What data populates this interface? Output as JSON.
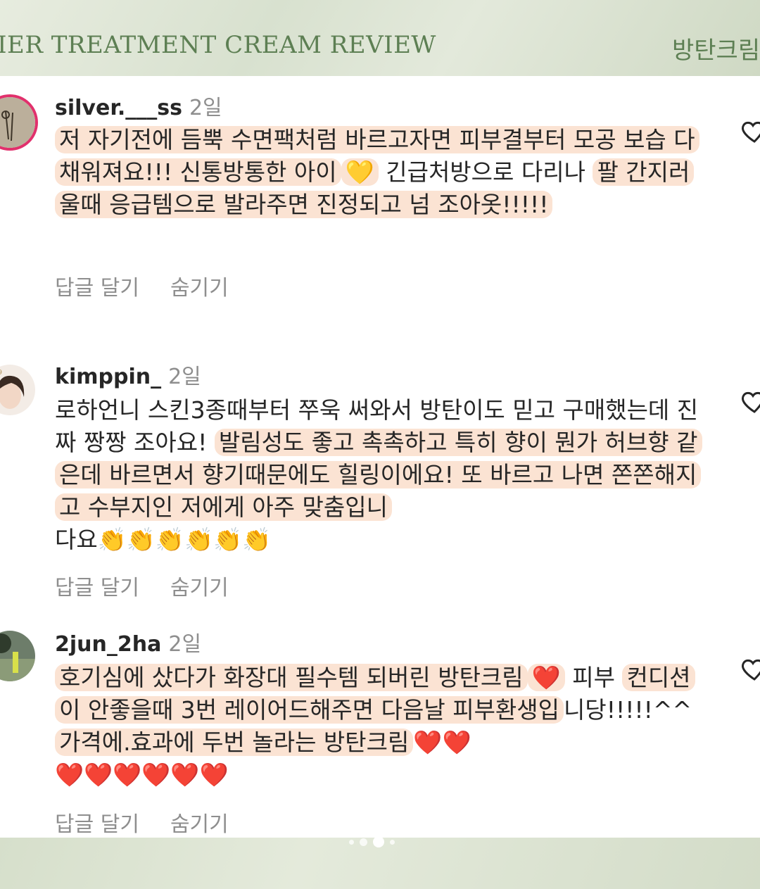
{
  "banner": {
    "title": "RIER TREATMENT CREAM REVIEW",
    "right_text": "방탄크림"
  },
  "comments": [
    {
      "username": "silver.___ss",
      "time": "2일",
      "segments": [
        {
          "text": "저 자기전에 듬뿍 수면팩처럼 바르고자면 피부결부터 모공 보습 다 채워져요!!! 신통방통한 아이",
          "hl": true
        },
        {
          "text": "💛",
          "hl": true,
          "emoji": "yellow-heart"
        },
        {
          "text": " 긴급처방으로 다리나 ",
          "hl": false
        },
        {
          "text": "팔 간지러울때 응급템으로 발라주면 진정되고 넘 조아옷!!!!!",
          "hl": true
        }
      ],
      "reply_label": "답글 달기",
      "hide_label": "숨기기"
    },
    {
      "username": "kimppin_",
      "time": "2일",
      "segments": [
        {
          "text": "로하언니 스킨3종때부터 쭈욱 써와서 방탄이도 믿고 구매했는데 진짜 짱짱 조아요! ",
          "hl": false
        },
        {
          "text": "발림성도 좋고 촉촉하고 특히 향이 뭔가 허브향 같은데 바르면서 향기때문에도 힐링이에요! 또 바르고 나면 쫀쫀해지고 수부지인 저에게 아주 맞춤입니",
          "hl": true
        },
        {
          "text": "다요",
          "hl": false
        },
        {
          "text": "👏👏👏👏👏👏",
          "hl": false,
          "emoji": "clap"
        }
      ],
      "reply_label": "답글 달기",
      "hide_label": "숨기기"
    },
    {
      "username": "2jun_2ha",
      "time": "2일",
      "segments": [
        {
          "text": "호기심에 샀다가 화장대 필수템 되버린 방탄크림",
          "hl": true
        },
        {
          "text": "❤️",
          "hl": true,
          "emoji": "red-heart"
        },
        {
          "text": " 피부 ",
          "hl": false
        },
        {
          "text": "컨디션이 안좋을때 3번 레이어드해주면 다음날 피부환생입",
          "hl": true
        },
        {
          "text": "니당!!!!!^^ ",
          "hl": false
        },
        {
          "text": "가격에.효과에 두번 놀라는 방탄크림",
          "hl": true
        },
        {
          "text": "❤️❤️",
          "hl": false,
          "emoji": "red-heart"
        },
        {
          "text": " ❤️❤️❤️❤️❤️❤️",
          "hl": false,
          "emoji": "red-heart"
        }
      ],
      "reply_label": "답글 달기",
      "hide_label": "숨기기"
    }
  ]
}
